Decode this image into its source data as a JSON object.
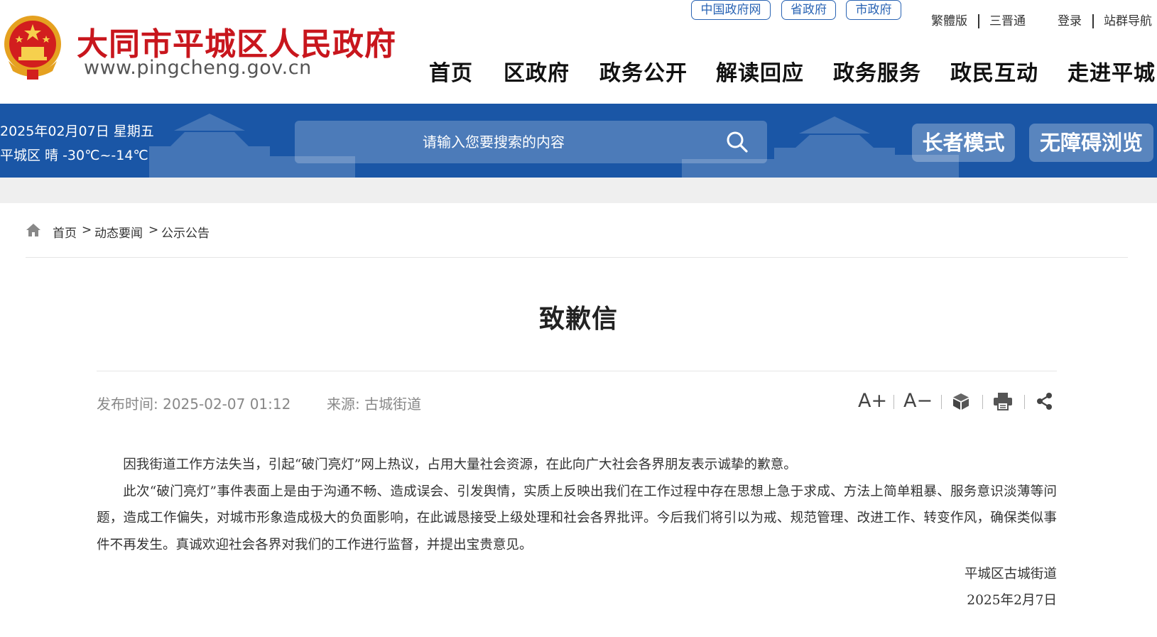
{
  "header": {
    "site_title": "大同市平城区人民政府",
    "site_url": "www.pingcheng.gov.cn",
    "emblem": "national-emblem-icon",
    "top_links": [
      "中国政府网",
      "省政府",
      "市政府"
    ],
    "utility_links": {
      "traditional": "繁體版",
      "sanjin": "三晋通",
      "login": "登录",
      "site_nav": "站群导航"
    },
    "nav": [
      "首页",
      "区政府",
      "政务公开",
      "解读回应",
      "政务服务",
      "政民互动",
      "走进平城"
    ]
  },
  "banner": {
    "date": "2025年02月07日 星期五",
    "weather": "平城区 晴 -30℃~-14℃",
    "search_placeholder": "请输入您要搜索的内容",
    "elder_mode": "长者模式",
    "accessible_mode": "无障碍浏览"
  },
  "breadcrumb": {
    "items": [
      "首页",
      "动态要闻",
      "公示公告"
    ],
    "separator": ">"
  },
  "article": {
    "title": "致歉信",
    "published_label": "发布时间:",
    "published_value": "2025-02-07 01:12",
    "source_label": "来源:",
    "source_value": "古城街道",
    "tools": {
      "font_larger": "A+",
      "font_smaller": "A−",
      "cube_icon": "3d-cube-icon",
      "print_icon": "printer-icon",
      "share_icon": "share-icon"
    },
    "paragraphs": [
      "因我街道工作方法失当，引起“破门亮灯”网上热议，占用大量社会资源，在此向广大社会各界朋友表示诚挚的歉意。",
      "此次“破门亮灯”事件表面上是由于沟通不畅、造成误会、引发舆情，实质上反映出我们在工作过程中存在思想上急于求成、方法上简单粗暴、服务意识淡薄等问题，造成工作偏失，对城市形象造成极大的负面影响，在此诚恳接受上级处理和社会各界批评。今后我们将引以为戒、规范管理、改进工作、转变作风，确保类似事件不再发生。真诚欢迎社会各界对我们的工作进行监督，并提出宝贵意见。"
    ],
    "signature": "平城区古城街道",
    "sign_date": "2025年2月7日"
  },
  "colors": {
    "brand_red": "#c8161d",
    "banner_blue": "#1a56a6",
    "pill_blue": "#2a64b4"
  }
}
